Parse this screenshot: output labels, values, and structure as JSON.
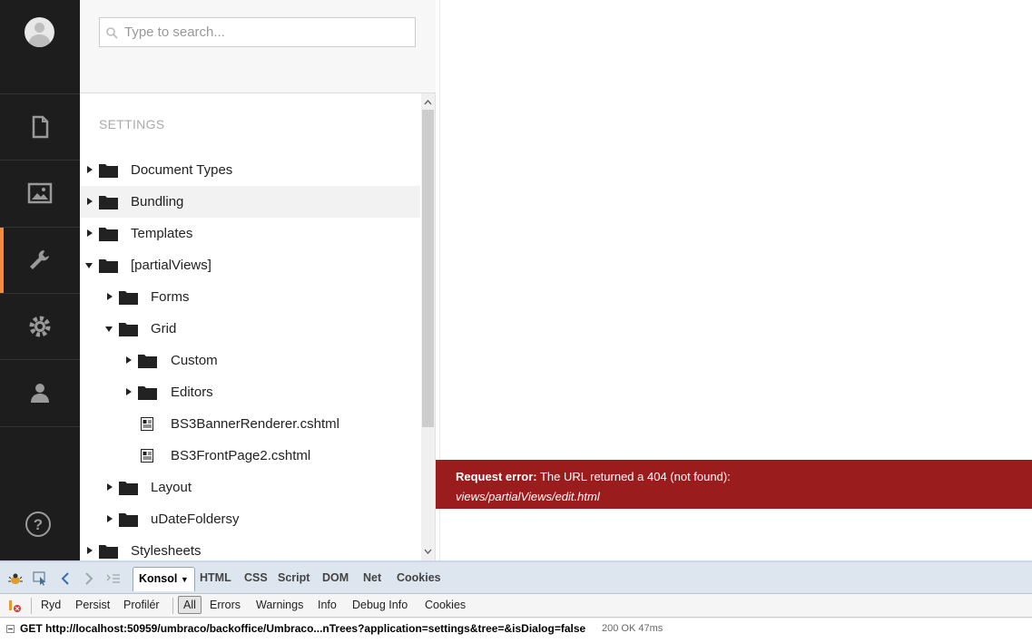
{
  "search": {
    "placeholder": "Type to search..."
  },
  "tree": {
    "section_title": "SETTINGS",
    "items": [
      {
        "label": "Document Types"
      },
      {
        "label": "Bundling"
      },
      {
        "label": "Templates"
      },
      {
        "label": "[partialViews]"
      },
      {
        "label": "Forms"
      },
      {
        "label": "Grid"
      },
      {
        "label": "Custom"
      },
      {
        "label": "Editors"
      },
      {
        "label": "BS3BannerRenderer.cshtml"
      },
      {
        "label": "BS3FrontPage2.cshtml"
      },
      {
        "label": "Layout"
      },
      {
        "label": "uDateFoldersy"
      },
      {
        "label": "Stylesheets"
      }
    ]
  },
  "nav": {
    "items": [
      "content-icon",
      "media-icon",
      "developer-icon",
      "settings-icon",
      "users-icon"
    ],
    "active": "developer-icon",
    "accent": "#f58a3d"
  },
  "error": {
    "prefix": "Request error:",
    "message": "The URL returned a 404 (not found):",
    "path": "views/partialViews/edit.html",
    "color": "#9b1c1c"
  },
  "firebug": {
    "tabs": [
      "Konsol",
      "HTML",
      "CSS",
      "Script",
      "DOM",
      "Net",
      "Cookies"
    ],
    "toolbar": [
      "Ryd",
      "Persist",
      "Profilér",
      "All",
      "Errors",
      "Warnings",
      "Info",
      "Debug Info",
      "Cookies"
    ],
    "request": "GET http://localhost:50959/umbraco/backoffice/Umbraco...nTrees?application=settings&tree=&isDialog=false",
    "status": "200 OK 47ms"
  }
}
